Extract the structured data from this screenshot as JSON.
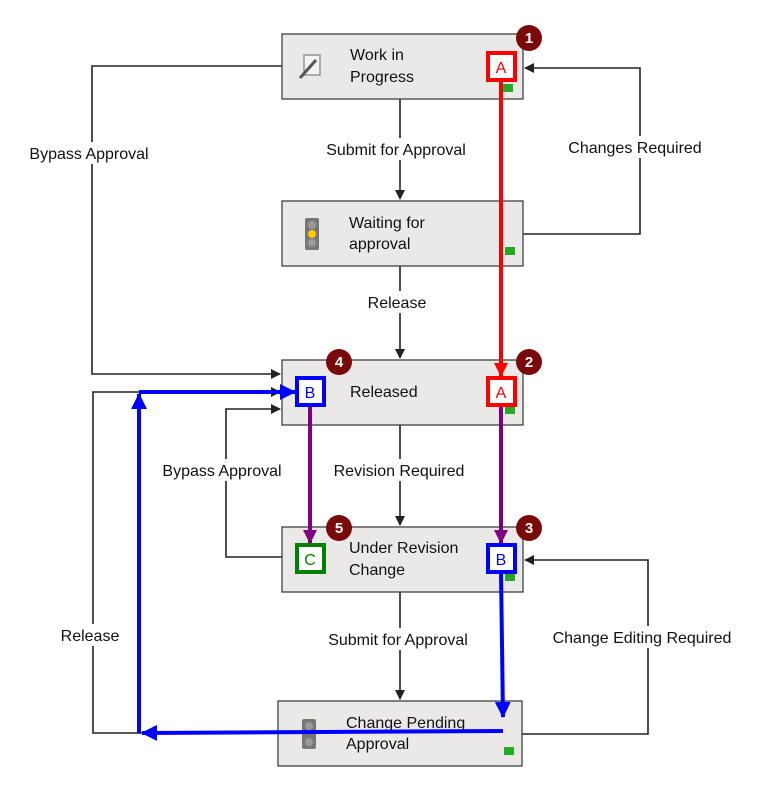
{
  "states": {
    "work_in_progress": [
      "Work in",
      "Progress"
    ],
    "waiting": [
      "Waiting for",
      "approval"
    ],
    "released": [
      "Released"
    ],
    "under_revision": [
      "Under Revision",
      "Change"
    ],
    "change_pending": [
      "Change Pending",
      "Approval"
    ]
  },
  "transitions": {
    "bypass1": "Bypass Approval",
    "submit1": "Submit for Approval",
    "changes_required": "Changes Required",
    "release1": "Release",
    "revision_required": "Revision Required",
    "bypass2": "Bypass Approval",
    "submit2": "Submit for Approval",
    "change_editing_required": "Change Editing Required",
    "release2": "Release"
  },
  "badges": [
    "1",
    "2",
    "3",
    "4",
    "5"
  ],
  "markers": {
    "a": "A",
    "b": "B",
    "c": "C"
  },
  "colors": {
    "red": "#ff0000",
    "blue": "#0000ff",
    "green": "#008000",
    "purple": "#800080",
    "badge": "#7a0a0a"
  }
}
